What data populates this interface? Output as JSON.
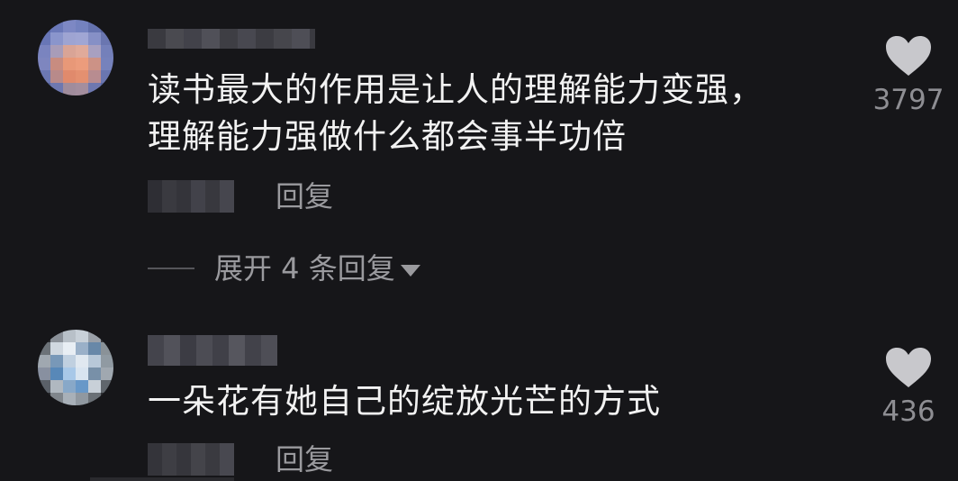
{
  "comments": [
    {
      "text_lines": [
        "读书最大的作用是让人的理解能力变强，",
        "理解能力强做什么都会事半功倍"
      ],
      "reply_label": "回复",
      "like_count": "3797",
      "expand_label": "展开 4 条回复"
    },
    {
      "text_lines": [
        "一朵花有她自己的绽放光芒的方式"
      ],
      "reply_label": "回复",
      "like_count": "436"
    }
  ],
  "icons": {
    "like": "heart-icon",
    "expand": "triangle-down-icon"
  },
  "colors": {
    "background": "#161619",
    "text": "#f2f2f2",
    "secondary": "#9a9a9e",
    "heart": "#c8c8cc"
  }
}
